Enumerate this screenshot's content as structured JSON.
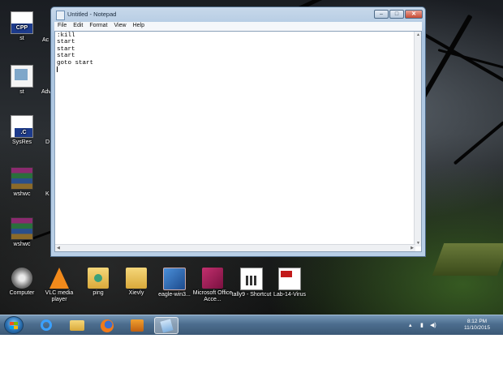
{
  "notepad": {
    "title": "Untitled - Notepad",
    "menu": [
      "File",
      "Edit",
      "Format",
      "View",
      "Help"
    ],
    "content": ":kill\nstart\nstart\nstart\ngoto start"
  },
  "desktop_icons": {
    "cpp": "st",
    "st2": "st",
    "sysres": "SysRes",
    "wshwc1": "wshwc",
    "wshwc2": "wshwc",
    "computer": "Computer",
    "vlc": "VLC media player",
    "ping": "ping",
    "xievly": "Xievly",
    "eagle": "eagle-win3...",
    "msoffice": "Microsoft Office Acce...",
    "tally": "tally9 - Shortcut",
    "lab": "Lab-14-Virus"
  },
  "peek": {
    "a1": "Ac",
    "a2": "Adv",
    "a3": "D",
    "a4": "K"
  },
  "taskbar": {
    "time": "8:12 PM",
    "date": "11/10/2015"
  },
  "colors": {
    "taskbar": "#4c6d8e",
    "window_frame": "#b9cfe6",
    "close": "#c74a33"
  }
}
